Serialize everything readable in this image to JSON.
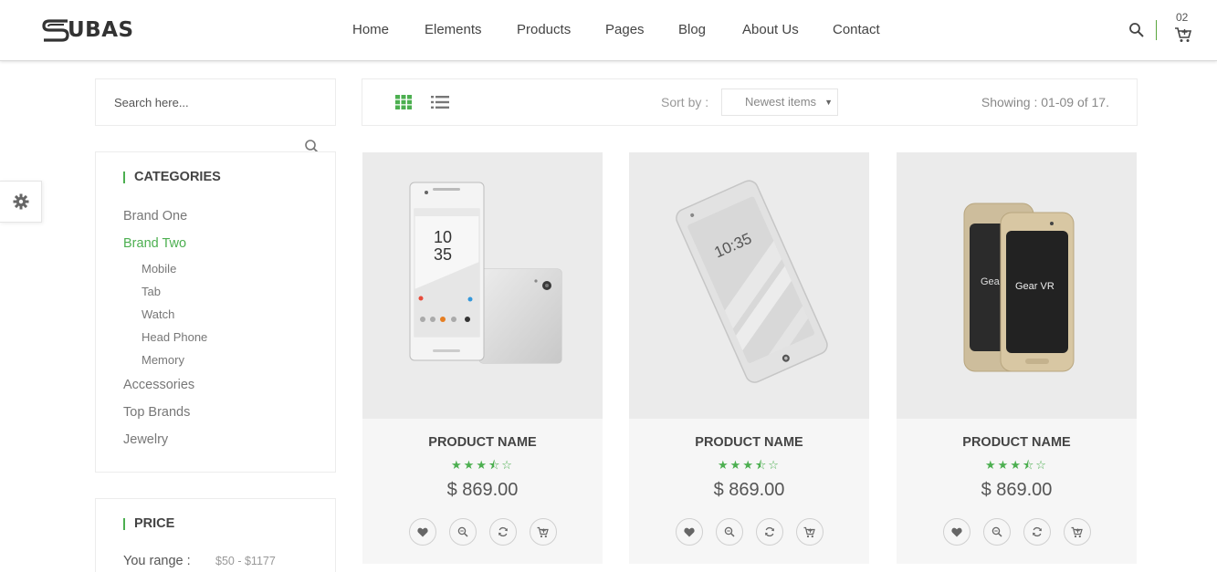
{
  "brand": {
    "logo_text": "UBAS",
    "accent": "#4caf50"
  },
  "nav": [
    "Home",
    "Elements",
    "Products",
    "Pages",
    "Blog",
    "About Us",
    "Contact"
  ],
  "cart": {
    "count": "02"
  },
  "search": {
    "placeholder": "Search here..."
  },
  "categories": {
    "title": "CATEGORIES",
    "items": [
      "Brand One",
      "Brand Two",
      "Accessories",
      "Top Brands",
      "Jewelry"
    ],
    "active": "Brand Two",
    "sub_items": [
      "Mobile",
      "Tab",
      "Watch",
      "Head Phone",
      "Memory"
    ]
  },
  "price": {
    "title": "PRICE",
    "range_label": "You range :",
    "range_value": "$50 - $1177"
  },
  "toolbar": {
    "sort_label": "Sort by :",
    "sort_value": "Newest items",
    "showing": "Showing : 01-09 of 17."
  },
  "products": [
    {
      "name": "PRODUCT NAME",
      "stars": "★★★⯪☆",
      "rating": 3.5,
      "price": "$ 869.00",
      "image": "white-phone-front-back"
    },
    {
      "name": "PRODUCT NAME",
      "stars": "★★★⯪☆",
      "rating": 3.5,
      "price": "$ 869.00",
      "image": "white-phone-tilted"
    },
    {
      "name": "PRODUCT NAME",
      "stars": "★★★⯪☆",
      "rating": 3.5,
      "price": "$ 869.00",
      "image": "gold-phones-pair"
    }
  ],
  "phone_screens": {
    "time_hour": "10",
    "time_min": "35",
    "time_tilted": "10:35",
    "gear_text": "Gear VR"
  },
  "icons": [
    "search-icon",
    "cart-icon",
    "gear-icon",
    "grid-view-icon",
    "list-view-icon",
    "heart-icon",
    "zoom-icon",
    "refresh-icon",
    "add-to-cart-icon"
  ]
}
